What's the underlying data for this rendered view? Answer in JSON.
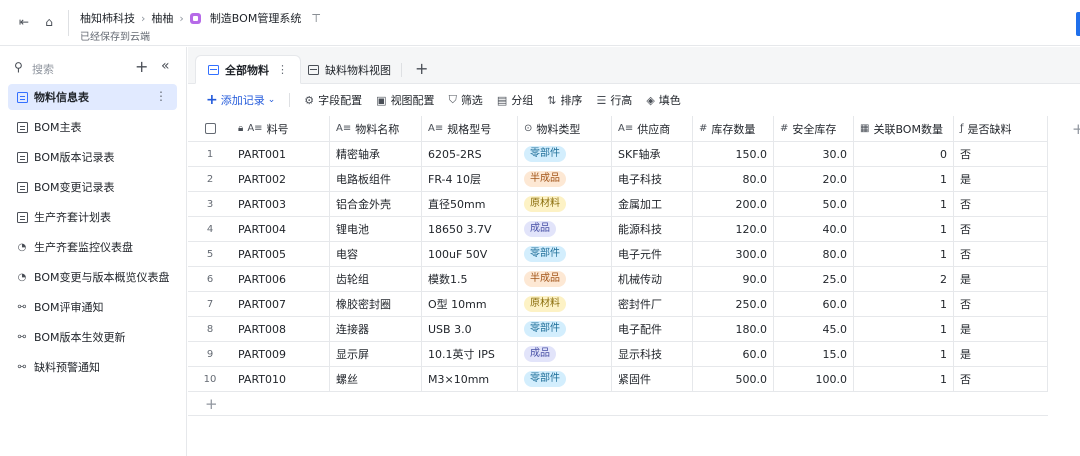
{
  "header": {
    "breadcrumbs": [
      "柚知柿科技",
      "柚柚",
      "制造BOM管理系统"
    ],
    "saved_status": "已经保存到云端"
  },
  "sidebar": {
    "search_placeholder": "搜索",
    "items": [
      {
        "label": "物料信息表",
        "icon": "table-icon",
        "active": true
      },
      {
        "label": "BOM主表",
        "icon": "table-icon"
      },
      {
        "label": "BOM版本记录表",
        "icon": "table-icon"
      },
      {
        "label": "BOM变更记录表",
        "icon": "table-icon"
      },
      {
        "label": "生产齐套计划表",
        "icon": "table-icon"
      },
      {
        "label": "生产齐套监控仪表盘",
        "icon": "dashboard-icon"
      },
      {
        "label": "BOM变更与版本概览仪表盘",
        "icon": "dashboard-icon"
      },
      {
        "label": "BOM评审通知",
        "icon": "workflow-icon"
      },
      {
        "label": "BOM版本生效更新",
        "icon": "workflow-icon"
      },
      {
        "label": "缺料预警通知",
        "icon": "workflow-icon"
      }
    ]
  },
  "tabs": [
    {
      "label": "全部物料",
      "active": true
    },
    {
      "label": "缺料物料视图",
      "active": false
    }
  ],
  "toolbar": {
    "add_record": "添加记录",
    "field_config": "字段配置",
    "view_config": "视图配置",
    "filter": "筛选",
    "group": "分组",
    "sort": "排序",
    "row_height": "行高",
    "fill_color": "填色"
  },
  "table": {
    "columns": [
      "料号",
      "物料名称",
      "规格型号",
      "物料类型",
      "供应商",
      "库存数量",
      "安全库存",
      "关联BOM数量",
      "是否缺料"
    ],
    "tag_colors": {
      "零部件": {
        "bg": "#d3eefd",
        "fg": "#1f6f99"
      },
      "半成品": {
        "bg": "#fde8d4",
        "fg": "#a3561a"
      },
      "原材料": {
        "bg": "#fdf2c5",
        "fg": "#8a6d0c"
      },
      "成品": {
        "bg": "#e2e4fa",
        "fg": "#4850a6"
      }
    },
    "rows": [
      {
        "n": "1",
        "code": "PART001",
        "name": "精密轴承",
        "spec": "6205-2RS",
        "type": "零部件",
        "supplier": "SKF轴承",
        "stock": "150.0",
        "safety": "30.0",
        "bom": "0",
        "short": "否"
      },
      {
        "n": "2",
        "code": "PART002",
        "name": "电路板组件",
        "spec": "FR-4 10层",
        "type": "半成品",
        "supplier": "电子科技",
        "stock": "80.0",
        "safety": "20.0",
        "bom": "1",
        "short": "是"
      },
      {
        "n": "3",
        "code": "PART003",
        "name": "铝合金外壳",
        "spec": "直径50mm",
        "type": "原材料",
        "supplier": "金属加工",
        "stock": "200.0",
        "safety": "50.0",
        "bom": "1",
        "short": "否"
      },
      {
        "n": "4",
        "code": "PART004",
        "name": "锂电池",
        "spec": "18650 3.7V",
        "type": "成品",
        "supplier": "能源科技",
        "stock": "120.0",
        "safety": "40.0",
        "bom": "1",
        "short": "否"
      },
      {
        "n": "5",
        "code": "PART005",
        "name": "电容",
        "spec": "100uF 50V",
        "type": "零部件",
        "supplier": "电子元件",
        "stock": "300.0",
        "safety": "80.0",
        "bom": "1",
        "short": "否"
      },
      {
        "n": "6",
        "code": "PART006",
        "name": "齿轮组",
        "spec": "模数1.5",
        "type": "半成品",
        "supplier": "机械传动",
        "stock": "90.0",
        "safety": "25.0",
        "bom": "2",
        "short": "是"
      },
      {
        "n": "7",
        "code": "PART007",
        "name": "橡胶密封圈",
        "spec": "O型 10mm",
        "type": "原材料",
        "supplier": "密封件厂",
        "stock": "250.0",
        "safety": "60.0",
        "bom": "1",
        "short": "否"
      },
      {
        "n": "8",
        "code": "PART008",
        "name": "连接器",
        "spec": "USB 3.0",
        "type": "零部件",
        "supplier": "电子配件",
        "stock": "180.0",
        "safety": "45.0",
        "bom": "1",
        "short": "是"
      },
      {
        "n": "9",
        "code": "PART009",
        "name": "显示屏",
        "spec": "10.1英寸 IPS",
        "type": "成品",
        "supplier": "显示科技",
        "stock": "60.0",
        "safety": "15.0",
        "bom": "1",
        "short": "是"
      },
      {
        "n": "10",
        "code": "PART010",
        "name": "螺丝",
        "spec": "M3×10mm",
        "type": "零部件",
        "supplier": "紧固件",
        "stock": "500.0",
        "safety": "100.0",
        "bom": "1",
        "short": "否"
      }
    ]
  }
}
